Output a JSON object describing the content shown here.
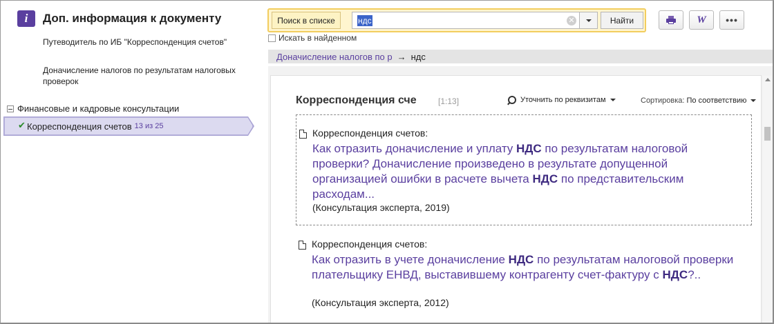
{
  "left_panel": {
    "title": "Доп. информация к документу",
    "links": [
      "Путеводитель по ИБ \"Корреспонденция счетов\"",
      "Доначисление налогов по результатам налоговых проверок"
    ],
    "tree": {
      "group": "Финансовые и кадровые консультации",
      "item": "Корреспонденция счетов",
      "item_count": "13 из 25"
    }
  },
  "search": {
    "scope_button": "Поиск в списке",
    "query": "ндс",
    "find_button": "Найти",
    "search_in_found": "Искать в найденном"
  },
  "toolbar": {
    "print_icon": "printer-icon",
    "word_label": "W",
    "more_label": "•••"
  },
  "breadcrumb": {
    "link": "Доначисление налогов по р",
    "arrow": "→",
    "current": "ндс"
  },
  "list": {
    "title": "Корреспонденция сче",
    "range": "[1:13]",
    "refine_label": "Уточнить по реквизитам",
    "sort_label": "Сортировка:",
    "sort_value": "По соответствию",
    "results": [
      {
        "source": "Корреспонденция счетов:",
        "parts": [
          "Как отразить доначисление и уплату ",
          "НДС",
          " по результатам налоговой проверки? Доначисление произведено в результате допущенной организацией ошибки в расчете вычета ",
          "НДС",
          " по представительским расходам..."
        ],
        "meta": "(Консультация эксперта, 2019)"
      },
      {
        "source": "Корреспонденция счетов:",
        "parts": [
          "Как отразить в учете доначисление ",
          "НДС",
          " по результатам налоговой проверки плательщику ЕНВД, выставившему контрагенту счет-фактуру с ",
          "НДС",
          "?.."
        ],
        "meta": "(Консультация эксперта, 2012)"
      }
    ]
  },
  "colors": {
    "accent": "#5a3f9f",
    "search_highlight": "#f2cd5e",
    "selection": "#3b64c9"
  }
}
